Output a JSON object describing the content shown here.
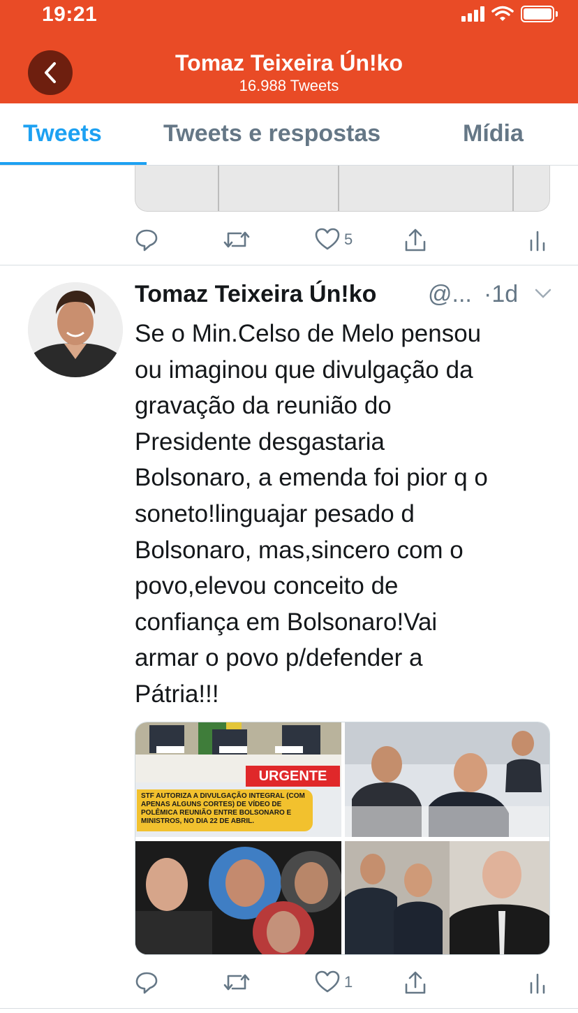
{
  "status_bar": {
    "time": "19:21"
  },
  "nav": {
    "title": "Tomaz Teixeira Ún!ko",
    "subtitle": "16.988 Tweets"
  },
  "tabs": [
    {
      "label": "Tweets",
      "active": true
    },
    {
      "label": "Tweets e respostas",
      "active": false
    },
    {
      "label": "Mídia",
      "active": false
    }
  ],
  "prev_tweet": {
    "like_count": "5"
  },
  "tweet": {
    "author": "Tomaz Teixeira Ún!ko",
    "handle": "@...",
    "time_ago": "·1d",
    "text": "Se o Min.Celso de Melo pensou\nou imaginou que divulgação da\ngravação da reunião do\nPresidente desgastaria\nBolsonaro, a emenda foi pior q o\nsoneto!linguajar pesado d\nBolsonaro, mas,sincero com o\npovo,elevou conceito de\nconfiança em Bolsonaro!Vai\narmar o povo p/defender a\nPátria!!!",
    "media": {
      "urgent_label": "URGENTE",
      "urgent_caption": "STF AUTORIZA A DIVULGAÇÃO INTEGRAL (COM APENAS ALGUNS CORTES) DE VÍDEO DE POLÊMICA REUNIÃO ENTRE BOLSONARO E MINISTROS, NO DIA 22 DE ABRIL."
    },
    "like_count": "1"
  },
  "colors": {
    "header_bg": "#e94b26",
    "accent": "#1da1f2",
    "muted": "#657786"
  }
}
